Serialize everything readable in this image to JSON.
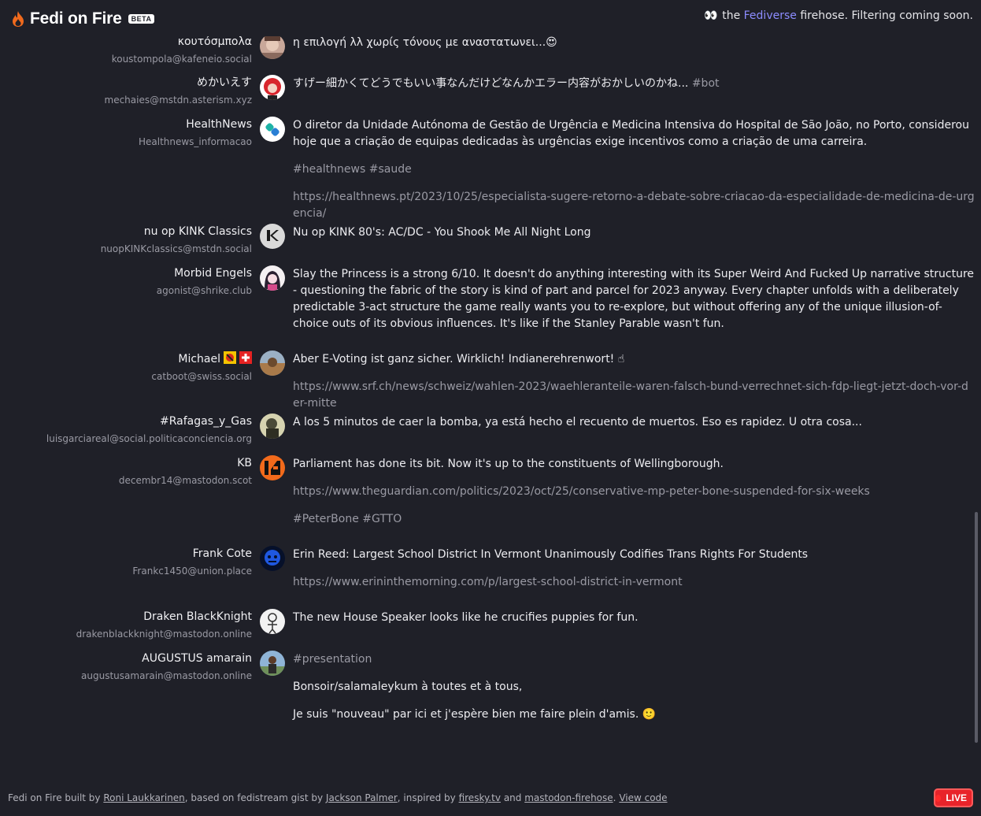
{
  "header": {
    "brand": "Fedi on Fire",
    "badge": "BETA",
    "tagline_eyes": "👀",
    "tagline_pre": "the",
    "tagline_link": "Fediverse",
    "tagline_post": "firehose. Filtering coming soon."
  },
  "posts": [
    {
      "name": "κουτόσμπολα",
      "handle": "koustompola@kafeneio.social",
      "text": "η επιλογή λλ χωρίς τόνους με αναστατωνει...😍"
    },
    {
      "name": "めかいえす",
      "handle": "mechaies@mstdn.asterism.xyz",
      "text": "すげー細かくてどうでもいい事なんだけどなんかエラー内容がおかしいのかね...",
      "tag": "#bot"
    },
    {
      "name": "HealthNews",
      "handle": "Healthnews_informacao",
      "text": "O diretor da Unidade Autónoma de Gestão de Urgência e Medicina Intensiva do Hospital de São João, no Porto, considerou hoje que a criação de equipas dedicadas às urgências exige incentivos como a criação de uma carreira.",
      "tags": "#healthnews #saude",
      "url": "https://healthnews.pt/2023/10/25/especialista-sugere-retorno-a-debate-sobre-criacao-da-especialidade-de-medicina-de-urgencia/"
    },
    {
      "name": "nu op KINK Classics",
      "handle": "nuopKINKclassics@mstdn.social",
      "text": "Nu op KINK 80's: AC/DC - You Shook Me All Night Long"
    },
    {
      "name": "Morbid Engels",
      "handle": "agonist@shrike.club",
      "text": "Slay the Princess is a strong 6/10. It doesn't do anything interesting with its Super Weird And Fucked Up narrative structure - questioning the fabric of the story is kind of part and parcel for 2023 anyway. Every chapter unfolds with a deliberately predictable 3-act structure the game really wants you to re-explore, but without offering any of the unique illusion-of-choice outs of its obvious influences. It's like if the Stanley Parable wasn't fun."
    },
    {
      "name": "Michael",
      "handle": "catboot@swiss.social",
      "text": "Aber E-Voting ist ganz sicher. Wirklich! Indianerehrenwort! ☝",
      "url": "https://www.srf.ch/news/schweiz/wahlen-2023/waehleranteile-waren-falsch-bund-verrechnet-sich-fdp-liegt-jetzt-doch-vor-der-mitte"
    },
    {
      "name": "#Rafagas_y_Gas",
      "handle": "luisgarciareal@social.politicaconciencia.org",
      "text": "A los 5 minutos de caer la bomba, ya está hecho el recuento de muertos. Eso es rapidez. U otra cosa..."
    },
    {
      "name": "KB",
      "handle": "decembr14@mastodon.scot",
      "text": "Parliament has done its bit. Now it's up to the constituents of Wellingborough.",
      "url": "https://www.theguardian.com/politics/2023/oct/25/conservative-mp-peter-bone-suspended-for-six-weeks",
      "tags": "#PeterBone #GTTO"
    },
    {
      "name": "Frank Cote",
      "handle": "Frankc1450@union.place",
      "text": "Erin Reed: Largest School District In Vermont Unanimously Codifies Trans Rights For Students",
      "url": "https://www.erininthemorning.com/p/largest-school-district-in-vermont"
    },
    {
      "name": "Draken BlackKnight",
      "handle": "drakenblackknight@mastodon.online",
      "text": "The new House Speaker looks like he crucifies puppies for fun."
    },
    {
      "name": "AUGUSTUS amarain",
      "handle": "augustusamarain@mastodon.online",
      "tags": "#presentation",
      "text": "Bonsoir/salamaleykum à toutes et à tous,",
      "text2": "Je suis \"nouveau\" par ici et j'espère bien me faire plein d'amis. 🙂"
    }
  ],
  "footer": {
    "t1": "Fedi on Fire built by",
    "l1": "Roni Laukkarinen",
    "t2": ", based on fedistream gist by",
    "l2": "Jackson Palmer",
    "t3": ", inspired by",
    "l3": "firesky.tv",
    "t4": "and",
    "l4": "mastodon-firehose",
    "t5": ".",
    "l5": "View code",
    "live": "LIVE"
  },
  "colors": {
    "background": "#1f2028",
    "link": "#8c8cff",
    "live": "#e8232a"
  }
}
